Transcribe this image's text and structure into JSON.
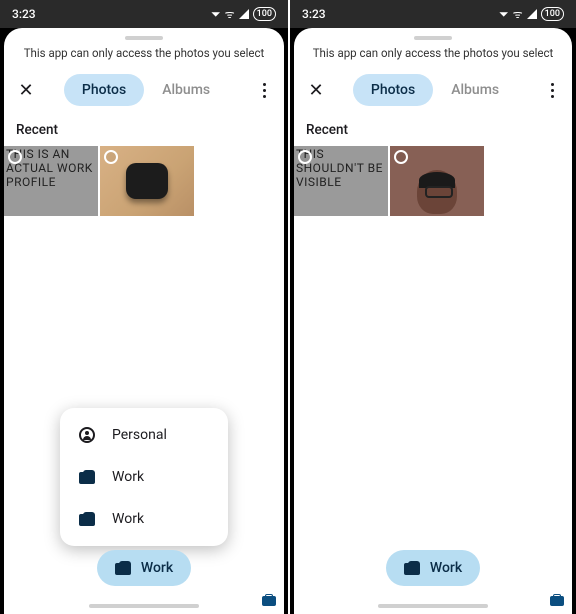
{
  "status": {
    "time": "3:23",
    "battery": "100"
  },
  "sheet": {
    "access_message": "This app can only access the photos you select",
    "tabs": {
      "photos": "Photos",
      "albums": "Albums"
    },
    "section_label": "Recent",
    "profile_chip": "Work"
  },
  "left": {
    "thumbs": [
      {
        "kind": "text",
        "text": "THIS IS AN ACTUAL WORK PROFILE"
      },
      {
        "kind": "earbuds"
      }
    ],
    "popup": [
      {
        "icon": "person",
        "label": "Personal"
      },
      {
        "icon": "briefcase",
        "label": "Work"
      },
      {
        "icon": "briefcase",
        "label": "Work"
      }
    ]
  },
  "right": {
    "thumbs": [
      {
        "kind": "text",
        "text": "THIS SHOULDN'T BE VISIBLE"
      },
      {
        "kind": "selfie"
      }
    ]
  }
}
